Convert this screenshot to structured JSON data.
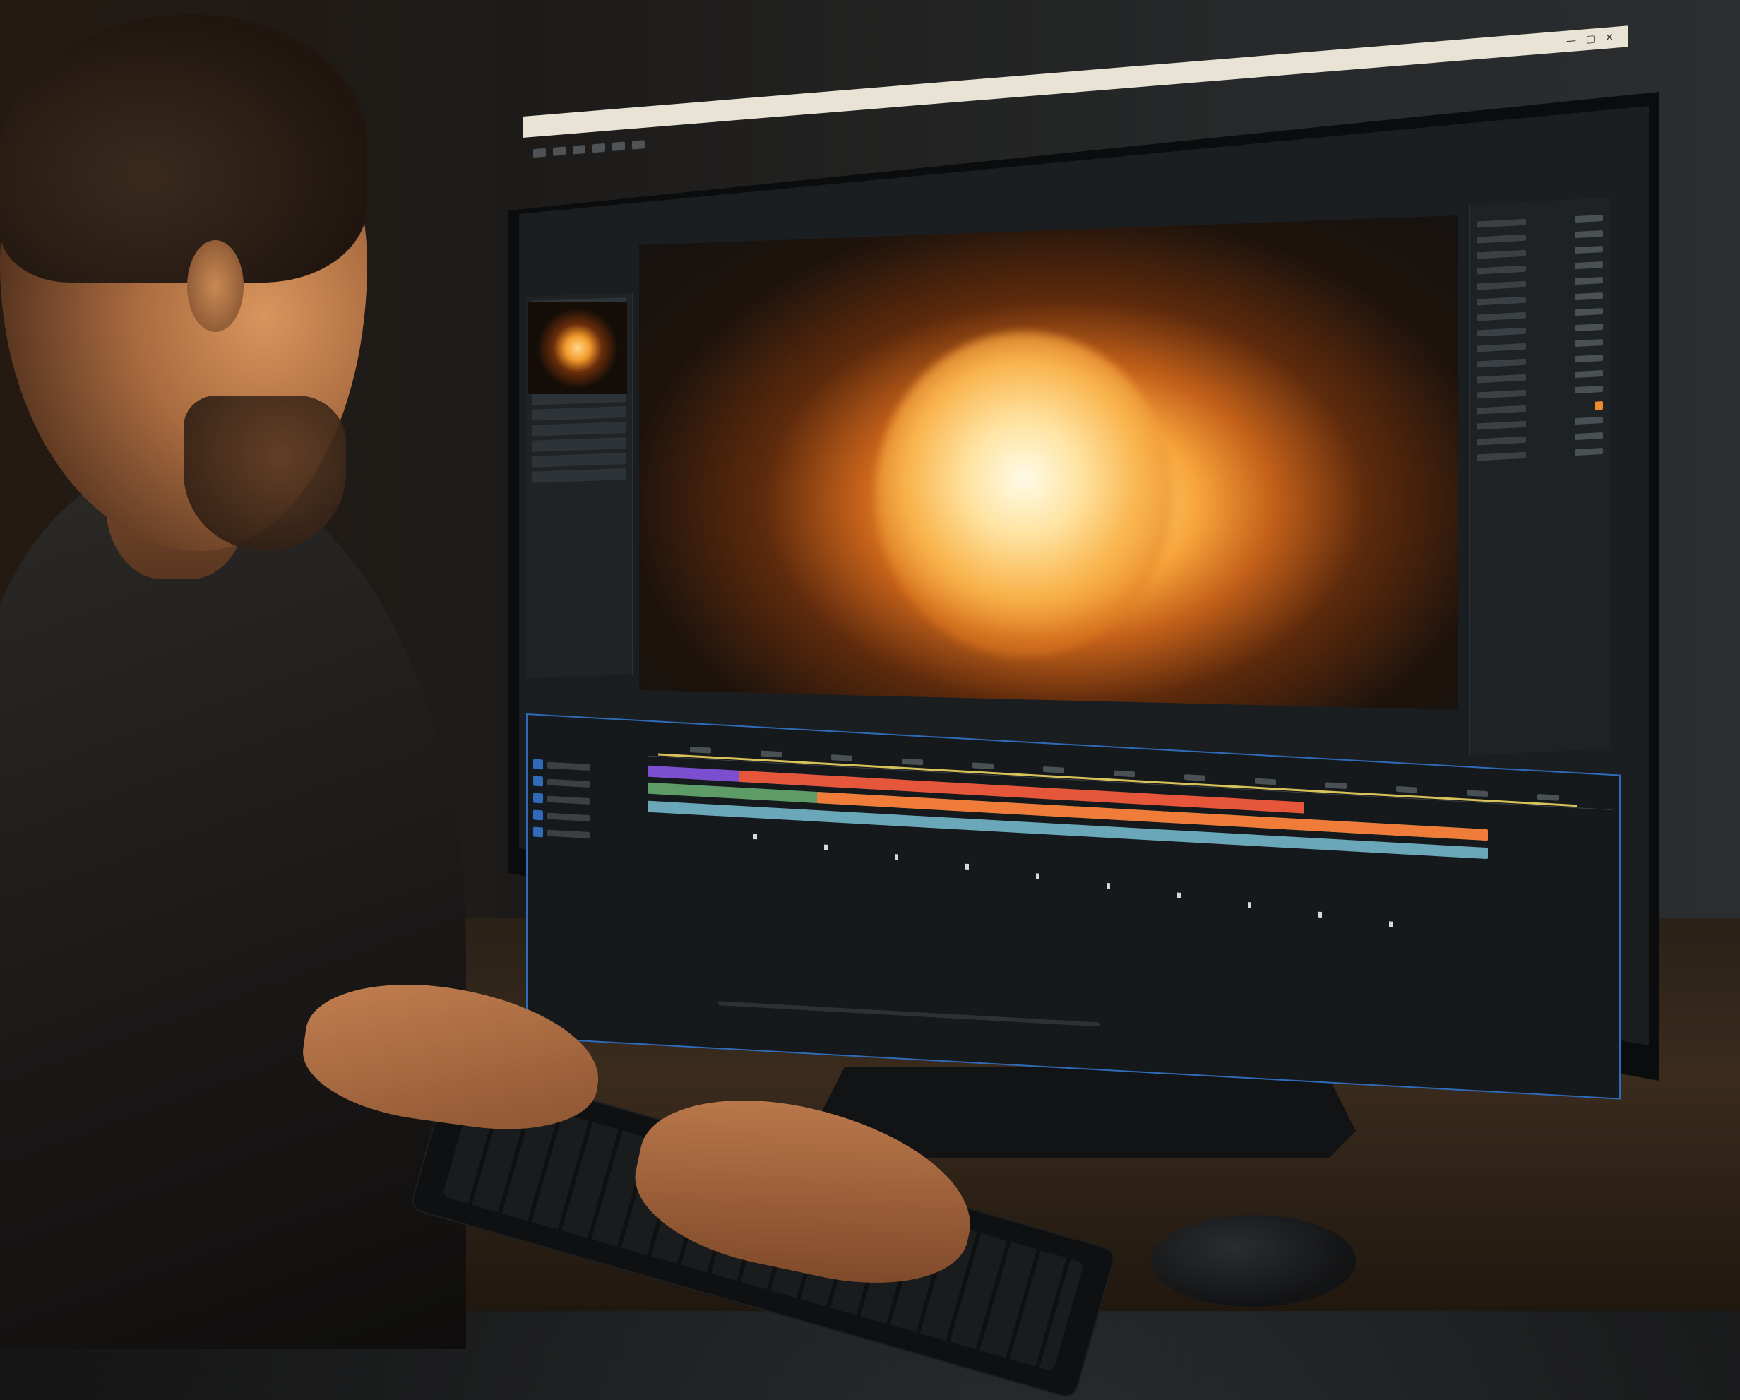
{
  "scene": {
    "description_visible_text": "",
    "palette": {
      "explosion_core": "#fff4cf",
      "explosion_mid": "#f7a53c",
      "screen_ui_dark": "#1b1e20",
      "timeline_accent": "#2f6bb8",
      "track_colors": [
        "#7b4fd0",
        "#e5563a",
        "#5d9b67",
        "#f07c3a",
        "#69a7b9"
      ]
    }
  },
  "ui": {
    "titlebar_text": "",
    "window_controls": [
      "minimize-icon",
      "maximize-icon",
      "close-icon"
    ],
    "timeline": {
      "tracks": [
        {
          "name": "",
          "color": "#7b4fd0"
        },
        {
          "name": "",
          "color": "#e5563a"
        },
        {
          "name": "",
          "color": "#5d9b67"
        },
        {
          "name": "",
          "color": "#f07c3a"
        },
        {
          "name": "",
          "color": "#69a7b9"
        }
      ]
    }
  }
}
